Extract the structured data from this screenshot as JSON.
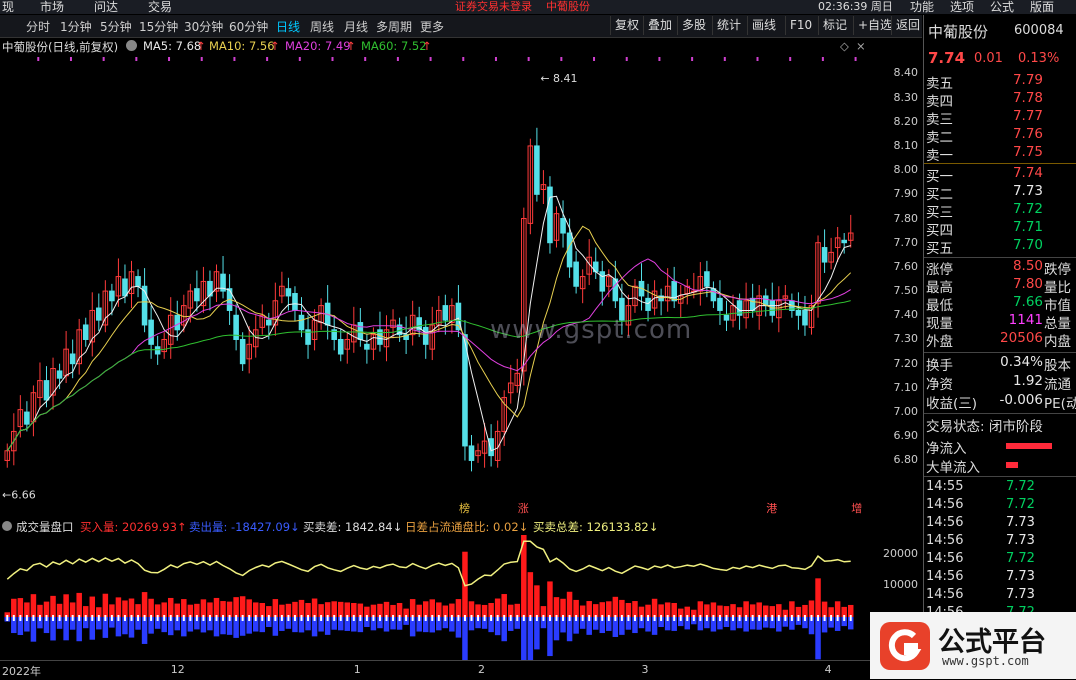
{
  "menubar": {
    "items": [
      "现",
      "市场",
      "问达",
      "交易"
    ],
    "notice": "证券交易未登录",
    "stock_name": "中葡股份",
    "time": "02:36:39 周日",
    "right_items": [
      "功能",
      "选项",
      "公式",
      "版面"
    ]
  },
  "toolbar": {
    "periods": [
      "分时",
      "1分钟",
      "5分钟",
      "15分钟",
      "30分钟",
      "60分钟",
      "日线",
      "周线",
      "月线",
      "多周期",
      "更多"
    ],
    "active": "日线",
    "buttons": [
      "复权",
      "叠加",
      "多股",
      "统计",
      "画线",
      "F10",
      "标记",
      "+自选",
      "返回"
    ]
  },
  "legend": {
    "title": "中葡股份(日线,前复权)",
    "ma5": "MA5: 7.68",
    "ma10": "MA10: 7.56",
    "ma20": "MA20: 7.49",
    "ma60": "MA60: 7.52",
    "arrow": "↑"
  },
  "colors": {
    "up": "#ff3b3b",
    "down": "#54e0e8",
    "ma5": "#f0f0f0",
    "ma10": "#e8d050",
    "ma20": "#e040e0",
    "ma60": "#30c030",
    "buy": "#ff1a1a",
    "sell": "#2a3cff",
    "diff_line": "#f0f080"
  },
  "chart_data": [
    {
      "type": "candlestick",
      "title": "中葡股份(日线,前复权)",
      "ylim": [
        6.62,
        8.48
      ],
      "yticks": [
        6.8,
        6.9,
        7.0,
        7.1,
        7.2,
        7.3,
        7.4,
        7.5,
        7.6,
        7.7,
        7.8,
        7.9,
        8.0,
        8.1,
        8.2,
        8.3,
        8.4
      ],
      "high_label": "8.41",
      "low_label": "6.66",
      "close": [
        6.84,
        6.92,
        7.01,
        6.95,
        7.08,
        7.13,
        7.05,
        7.18,
        7.14,
        7.26,
        7.2,
        7.34,
        7.3,
        7.42,
        7.38,
        7.5,
        7.46,
        7.56,
        7.48,
        7.58,
        7.52,
        7.36,
        7.28,
        7.24,
        7.3,
        7.4,
        7.34,
        7.44,
        7.5,
        7.46,
        7.54,
        7.48,
        7.58,
        7.5,
        7.42,
        7.3,
        7.2,
        7.28,
        7.34,
        7.4,
        7.36,
        7.46,
        7.52,
        7.48,
        7.42,
        7.34,
        7.28,
        7.38,
        7.44,
        7.36,
        7.3,
        7.24,
        7.3,
        7.36,
        7.3,
        7.26,
        7.32,
        7.28,
        7.34,
        7.38,
        7.32,
        7.3,
        7.4,
        7.34,
        7.28,
        7.36,
        7.42,
        7.38,
        7.44,
        7.34,
        6.86,
        6.8,
        6.84,
        6.88,
        6.82,
        6.92,
        7.06,
        7.12,
        7.16,
        7.8,
        8.1,
        7.9,
        7.94,
        7.7,
        7.82,
        7.74,
        7.6,
        7.52,
        7.56,
        7.64,
        7.58,
        7.5,
        7.56,
        7.46,
        7.38,
        7.44,
        7.52,
        7.48,
        7.42,
        7.5,
        7.46,
        7.52,
        7.46,
        7.48,
        7.52,
        7.5,
        7.56,
        7.52,
        7.46,
        7.42,
        7.38,
        7.44,
        7.4,
        7.46,
        7.42,
        7.48,
        7.44,
        7.4,
        7.46,
        7.48,
        7.42,
        7.4,
        7.36,
        7.44,
        7.7,
        7.62,
        7.66,
        7.72,
        7.7,
        7.74
      ],
      "series": [
        {
          "name": "MA5",
          "last": 7.68
        },
        {
          "name": "MA10",
          "last": 7.56
        },
        {
          "name": "MA20",
          "last": 7.49
        },
        {
          "name": "MA60",
          "last": 7.52
        }
      ],
      "events": [
        {
          "label": "榜",
          "index": 70,
          "color": "#e8c040"
        },
        {
          "label": "涨",
          "index": 79,
          "color": "#ff5050"
        },
        {
          "label": "港",
          "index": 117,
          "color": "#ff5050"
        },
        {
          "label": "增",
          "index": 130,
          "color": "#ff5050"
        }
      ],
      "xlabels": [
        {
          "label": "2022年",
          "index": 0
        },
        {
          "label": "12",
          "index": 25
        },
        {
          "label": "1",
          "index": 53
        },
        {
          "label": "2",
          "index": 72
        },
        {
          "label": "3",
          "index": 97
        },
        {
          "label": "4",
          "index": 125
        }
      ]
    },
    {
      "type": "bar",
      "title": "成交量盘口",
      "ylim": [
        -12000,
        26000
      ],
      "yticks": [
        10000,
        20000
      ],
      "buy_label": "买入量: 20269.93↑",
      "sell_label": "卖出量: -18427.09↓",
      "diff_label": "买卖差: 1842.84↓",
      "ratio_label": "日差占流通盘比: 0.02↓",
      "total_label": "买卖总差: 126133.82↓"
    }
  ],
  "panel": {
    "name": "中葡股份",
    "code": "600084",
    "price": "7.74",
    "change": "0.01",
    "change_pct": "0.13%",
    "asks": [
      {
        "label": "卖五",
        "price": "7.79"
      },
      {
        "label": "卖四",
        "price": "7.78"
      },
      {
        "label": "卖三",
        "price": "7.77"
      },
      {
        "label": "卖二",
        "price": "7.76"
      },
      {
        "label": "卖一",
        "price": "7.75"
      }
    ],
    "bids": [
      {
        "label": "买一",
        "price": "7.74",
        "color": "red"
      },
      {
        "label": "买二",
        "price": "7.73",
        "color": "white"
      },
      {
        "label": "买三",
        "price": "7.72",
        "color": "green"
      },
      {
        "label": "买四",
        "price": "7.71",
        "color": "green"
      },
      {
        "label": "买五",
        "price": "7.70",
        "color": "green"
      }
    ],
    "stats": [
      {
        "k": "涨停",
        "v": "8.50",
        "c": "red",
        "k2": "跌停"
      },
      {
        "k": "最高",
        "v": "7.80",
        "c": "red",
        "k2": "量比"
      },
      {
        "k": "最低",
        "v": "7.66",
        "c": "green",
        "k2": "市值"
      },
      {
        "k": "现量",
        "v": "1141",
        "c": "magenta",
        "k2": "总量"
      },
      {
        "k": "外盘",
        "v": "20506",
        "c": "red",
        "k2": "内盘"
      }
    ],
    "stats2": [
      {
        "k": "换手",
        "v": "0.34%",
        "c": "white",
        "k2": "股本"
      },
      {
        "k": "净资",
        "v": "1.92",
        "c": "white",
        "k2": "流通"
      },
      {
        "k": "收益(三)",
        "v": "-0.006",
        "c": "white",
        "k2": "PE(动"
      }
    ],
    "trade_status": "交易状态: 闭市阶段",
    "net_inflow": "净流入",
    "big_inflow": "大单流入",
    "ticks": [
      {
        "t": "14:55",
        "p": "7.72",
        "c": "green"
      },
      {
        "t": "14:56",
        "p": "7.72",
        "c": "green"
      },
      {
        "t": "14:56",
        "p": "7.73",
        "c": "white"
      },
      {
        "t": "14:56",
        "p": "7.73",
        "c": "white"
      },
      {
        "t": "14:56",
        "p": "7.72",
        "c": "green"
      },
      {
        "t": "14:56",
        "p": "7.73",
        "c": "white"
      },
      {
        "t": "14:56",
        "p": "7.73",
        "c": "white"
      },
      {
        "t": "14:56",
        "p": "7.72",
        "c": "green"
      }
    ]
  },
  "watermark": "www.gspt.com",
  "logo": {
    "name": "公式平台",
    "url": "www.gspt.com"
  }
}
